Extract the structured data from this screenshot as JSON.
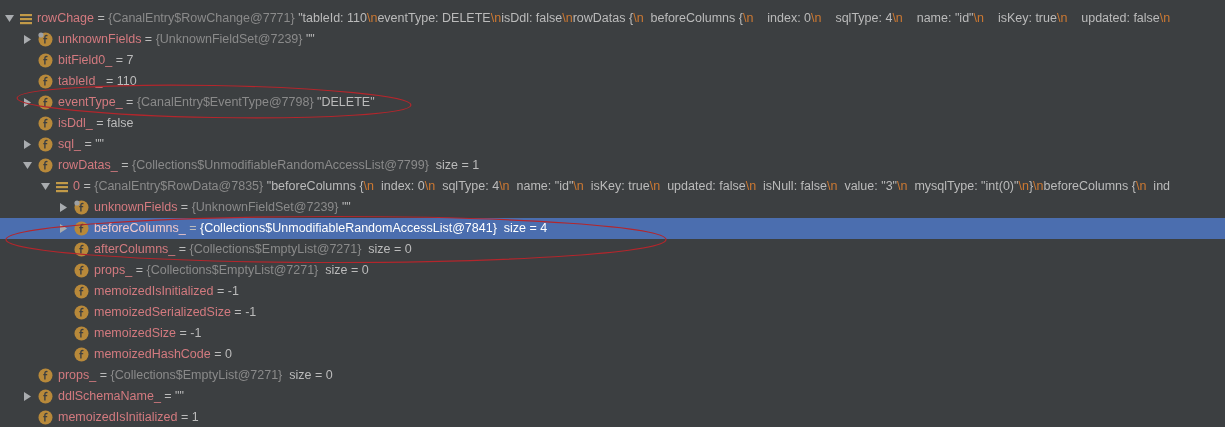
{
  "variables": [
    {
      "name": "rowChage",
      "kind": "list",
      "sign": "=",
      "type": "{CanalEntry$RowChange@7771}",
      "value": "\"tableId: 110\\neventType: DELETE\\nisDdl: false\\nrowDatas {\\n  beforeColumns {\\n    index: 0\\n    sqlType: 4\\n    name: \"id\"\\n    isKey: true\\n    updated: false\\n",
      "expanded": true,
      "selected": false,
      "children": [
        {
          "name": "unknownFields",
          "kind": "field-overlay",
          "sign": "=",
          "type": "{UnknownFieldSet@7239}",
          "value": "\"\"",
          "expanded": false,
          "selected": false
        },
        {
          "name": "bitField0_",
          "kind": "field",
          "sign": "=",
          "value": "7",
          "selected": false
        },
        {
          "name": "tableId_",
          "kind": "field",
          "sign": "=",
          "value": "110",
          "selected": false
        },
        {
          "name": "eventType_",
          "kind": "field",
          "sign": "=",
          "type": "{CanalEntry$EventType@7798}",
          "value": "\"DELETE\"",
          "expanded": false,
          "selected": false
        },
        {
          "name": "isDdl_",
          "kind": "field",
          "sign": "=",
          "value": "false",
          "selected": false
        },
        {
          "name": "sql_",
          "kind": "field",
          "sign": "=",
          "value": "\"\"",
          "expanded": false,
          "selected": false
        },
        {
          "name": "rowDatas_",
          "kind": "field",
          "sign": "=",
          "type": "{Collections$UnmodifiableRandomAccessList@7799}",
          "value": " size = 1",
          "expanded": true,
          "selected": false,
          "children": [
            {
              "name": "0",
              "kind": "list",
              "sign": "=",
              "type": "{CanalEntry$RowData@7835}",
              "value": "\"beforeColumns {\\n  index: 0\\n  sqlType: 4\\n  name: \"id\"\\n  isKey: true\\n  updated: false\\n  isNull: false\\n  value: \"3\"\\n  mysqlType: \"int(0)\"\\n}\\nbeforeColumns {\\n  ind",
              "expanded": true,
              "selected": false,
              "children": [
                {
                  "name": "unknownFields",
                  "kind": "field-overlay",
                  "sign": "=",
                  "type": "{UnknownFieldSet@7239}",
                  "value": "\"\"",
                  "expanded": false,
                  "selected": false
                },
                {
                  "name": "beforeColumns_",
                  "kind": "field",
                  "sign": "=",
                  "type": "{Collections$UnmodifiableRandomAccessList@7841}",
                  "value": " size = 4",
                  "expanded": false,
                  "selected": true
                },
                {
                  "name": "afterColumns_",
                  "kind": "field",
                  "sign": "=",
                  "type": "{Collections$EmptyList@7271}",
                  "value": " size = 0",
                  "selected": false
                },
                {
                  "name": "props_",
                  "kind": "field",
                  "sign": "=",
                  "type": "{Collections$EmptyList@7271}",
                  "value": " size = 0",
                  "selected": false
                },
                {
                  "name": "memoizedIsInitialized",
                  "kind": "field",
                  "sign": "=",
                  "value": "-1",
                  "selected": false
                },
                {
                  "name": "memoizedSerializedSize",
                  "kind": "field",
                  "sign": "=",
                  "value": "-1",
                  "selected": false
                },
                {
                  "name": "memoizedSize",
                  "kind": "field",
                  "sign": "=",
                  "value": "-1",
                  "selected": false
                },
                {
                  "name": "memoizedHashCode",
                  "kind": "field",
                  "sign": "=",
                  "value": "0",
                  "selected": false
                }
              ]
            }
          ]
        },
        {
          "name": "props_",
          "kind": "field",
          "sign": "=",
          "type": "{Collections$EmptyList@7271}",
          "value": " size = 0",
          "selected": false
        },
        {
          "name": "ddlSchemaName_",
          "kind": "field",
          "sign": "=",
          "value": "\"\"",
          "expanded": false,
          "selected": false
        },
        {
          "name": "memoizedIsInitialized",
          "kind": "field",
          "sign": "=",
          "value": "1",
          "selected": false
        }
      ]
    }
  ],
  "annotations": [
    {
      "kind": "ellipse",
      "color": "#b3262c"
    },
    {
      "kind": "ellipse",
      "color": "#b3262c"
    }
  ]
}
